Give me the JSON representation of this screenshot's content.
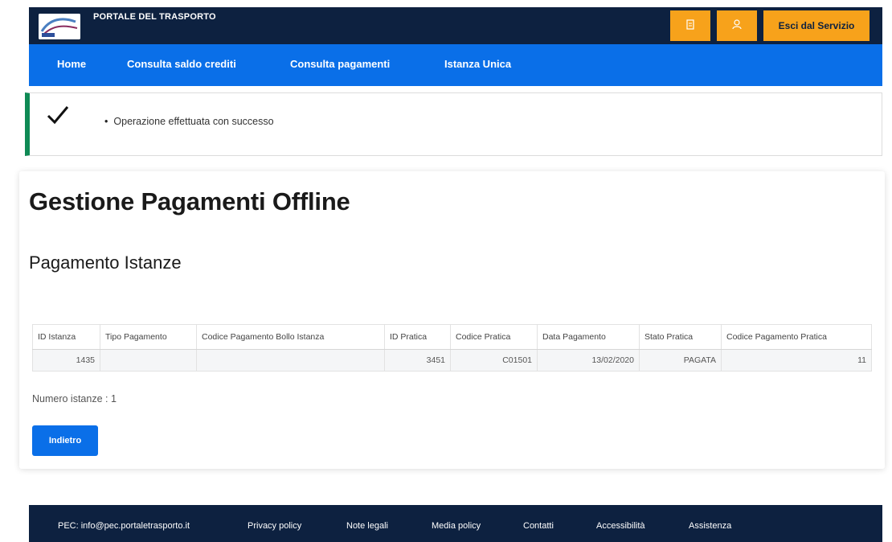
{
  "header": {
    "title": "PORTALE DEL TRASPORTO",
    "logo_icon": "portal-logo",
    "icon_button_a": "document-icon",
    "icon_button_b": "user-icon",
    "exit_label": "Esci dal Servizio",
    "accent": "#f7a21b",
    "background": "#0d2140"
  },
  "nav": {
    "background": "#0a6fe8",
    "items": [
      {
        "label": "Home"
      },
      {
        "label": "Consulta saldo crediti"
      },
      {
        "label": "Consulta pagamenti"
      },
      {
        "label": "Istanza Unica"
      }
    ]
  },
  "alert": {
    "icon": "check-icon",
    "message": "Operazione effettuata con successo",
    "accent": "#0f8a55"
  },
  "main": {
    "title": "Gestione Pagamenti Offline",
    "section_title": "Pagamento Istanze",
    "table": {
      "columns": [
        "ID Istanza",
        "Tipo Pagamento",
        "Codice Pagamento Bollo Istanza",
        "ID Pratica",
        "Codice Pratica",
        "Data Pagamento",
        "Stato Pratica",
        "Codice Pagamento Pratica"
      ],
      "rows": [
        [
          "1435",
          "",
          "",
          "3451",
          "C01501",
          "13/02/2020",
          "PAGATA",
          "11"
        ]
      ]
    },
    "count_text": "Numero istanze : 1",
    "back_label": "Indietro"
  },
  "footer": {
    "links": [
      {
        "label": "PEC: info@pec.portaletrasporto.it"
      },
      {
        "label": "Privacy policy"
      },
      {
        "label": "Note legali"
      },
      {
        "label": "Media policy"
      },
      {
        "label": "Contatti"
      },
      {
        "label": "Accessibilità"
      },
      {
        "label": "Assistenza"
      }
    ]
  }
}
